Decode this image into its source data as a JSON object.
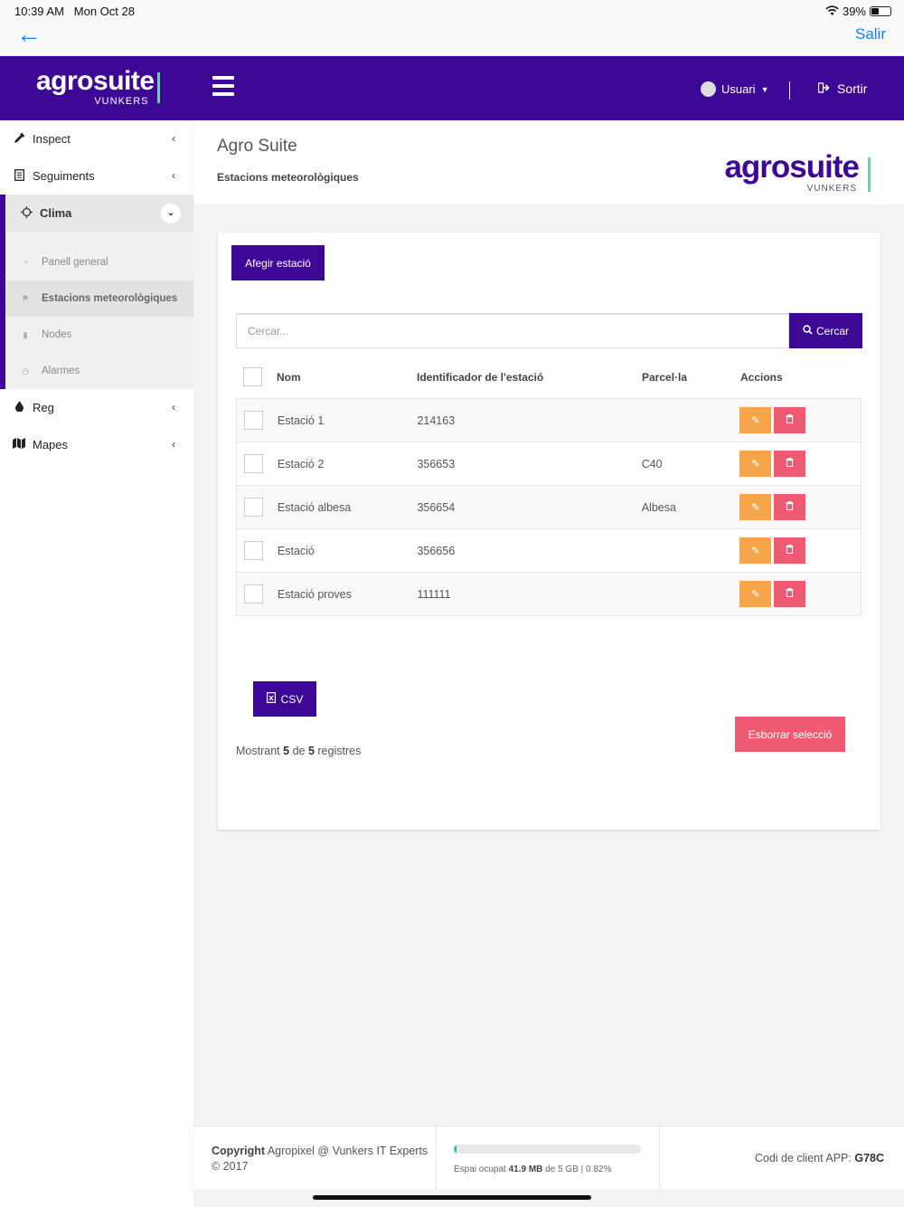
{
  "status_bar": {
    "time": "10:39 AM",
    "date": "Mon Oct 28",
    "battery": "39%",
    "battery_level": 0.39
  },
  "ios_nav": {
    "back_icon": "←",
    "exit_label": "Salir"
  },
  "header": {
    "logo_word": "agrosuite",
    "logo_sub": "VUNKERS",
    "user_label": "Usuari",
    "logout_label": "Sortir",
    "brand_color": "#3d0896"
  },
  "sidebar": {
    "items": [
      {
        "label": "Inspect",
        "icon": "eyedropper-icon"
      },
      {
        "label": "Seguiments",
        "icon": "document-icon"
      },
      {
        "label": "Clima",
        "icon": "sun-icon"
      },
      {
        "label": "Reg",
        "icon": "drop-icon"
      },
      {
        "label": "Mapes",
        "icon": "map-icon"
      }
    ],
    "clima_sub": [
      {
        "label": "Panell general",
        "icon": "dashboard-icon"
      },
      {
        "label": "Estacions meteorològiques",
        "icon": "flag-icon"
      },
      {
        "label": "Nodes",
        "icon": "phone-icon"
      },
      {
        "label": "Alarmes",
        "icon": "clock-icon"
      }
    ]
  },
  "page": {
    "title": "Agro Suite",
    "subtitle": "Estacions meteorològiques",
    "logo_word": "agrosuite",
    "logo_sub": "VUNKERS"
  },
  "card": {
    "add_button": "Afegir estació",
    "search_placeholder": "Cercar...",
    "search_button": "Cercar",
    "columns": {
      "name": "Nom",
      "id": "Identificador de l'estació",
      "parcel": "Parcel·la",
      "actions": "Accions"
    },
    "rows": [
      {
        "name": "Estació 1",
        "id": "214163",
        "parcel": ""
      },
      {
        "name": "Estació 2",
        "id": "356653",
        "parcel": "C40"
      },
      {
        "name": "Estació albesa",
        "id": "356654",
        "parcel": "Albesa"
      },
      {
        "name": "Estació",
        "id": "356656",
        "parcel": ""
      },
      {
        "name": "Estació proves",
        "id": "111111",
        "parcel": ""
      }
    ],
    "csv_button": "CSV",
    "delete_selection": "Esborrar selecció",
    "showing_prefix": "Mostrant",
    "showing_count": "5",
    "showing_mid": "de",
    "showing_total": "5",
    "showing_suffix": "registres"
  },
  "footer": {
    "copyright_bold": "Copyright",
    "copyright_text": "Agropixel @ Vunkers IT Experts © 2017",
    "storage_prefix": "Espai ocupat",
    "storage_used": "41.9 MB",
    "storage_suffix": "de 5 GB | 0.82%",
    "storage_fraction": 0.0082,
    "client_code_label": "Codi de client APP:",
    "client_code": "G78C"
  }
}
